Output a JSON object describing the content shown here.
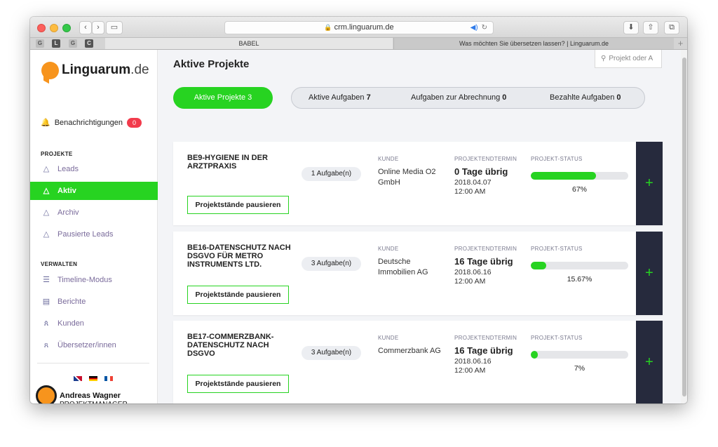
{
  "browser": {
    "url": "crm.linguarum.de",
    "tabs": [
      {
        "label": "BABEL"
      },
      {
        "label": "Was möchten Sie übersetzen lassen? | Linguarum.de"
      }
    ],
    "favicons": [
      "G",
      "L",
      "G",
      "C"
    ]
  },
  "sidebar": {
    "logo_name": "Linguarum",
    "logo_tld": ".de",
    "notifications_label": "Benachrichtigungen",
    "notifications_count": "0",
    "section_projects": "PROJEKTE",
    "section_manage": "VERWALTEN",
    "items": [
      {
        "label": "Leads",
        "icon": "triangle-icon"
      },
      {
        "label": "Aktiv",
        "icon": "triangle-icon"
      },
      {
        "label": "Archiv",
        "icon": "triangle-icon"
      },
      {
        "label": "Pausierte Leads",
        "icon": "triangle-icon"
      },
      {
        "label": "Timeline-Modus",
        "icon": "sliders-icon"
      },
      {
        "label": "Berichte",
        "icon": "document-icon"
      },
      {
        "label": "Kunden",
        "icon": "users-icon"
      },
      {
        "label": "Übersetzer/innen",
        "icon": "user-icon"
      }
    ],
    "user": {
      "name": "Andreas Wagner",
      "role": "PROJEKTMANAGER"
    }
  },
  "main": {
    "title": "Aktive Projekte",
    "search_placeholder": "Projekt oder A",
    "tabs": [
      {
        "label": "Aktive Projekte",
        "count": "3"
      },
      {
        "label": "Aktive Aufgaben",
        "count": "7"
      },
      {
        "label": "Aufgaben zur Abrechnung",
        "count": "0"
      },
      {
        "label": "Bezahlte Aufgaben",
        "count": "0"
      }
    ],
    "column_labels": {
      "customer": "KUNDE",
      "deadline": "PROJEKTENDTERMIN",
      "status": "PROJEKT-STATUS"
    },
    "pause_label": "Projektstände pausieren",
    "plus_label": "+",
    "projects": [
      {
        "name": "BE9-HYGIENE IN DER ARZTPRAXIS",
        "tasks": "1 Aufgabe(n)",
        "customer": "Online Media O2 GmbH",
        "days_left": "0 Tage übrig",
        "date": "2018.04.07",
        "time": "12:00 AM",
        "progress_label": "67%",
        "progress": 67
      },
      {
        "name": "BE16-DATENSCHUTZ NACH DSGVO FÜR METRO INSTRUMENTS LTD.",
        "tasks": "3 Aufgabe(n)",
        "customer": "Deutsche Immobilien AG",
        "days_left": "16 Tage übrig",
        "date": "2018.06.16",
        "time": "12:00 AM",
        "progress_label": "15.67%",
        "progress": 15.67
      },
      {
        "name": "BE17-COMMERZBANK-DATENSCHUTZ NACH DSGVO",
        "tasks": "3 Aufgabe(n)",
        "customer": "Commerzbank AG",
        "days_left": "16 Tage übrig",
        "date": "2018.06.16",
        "time": "12:00 AM",
        "progress_label": "7%",
        "progress": 7
      }
    ]
  },
  "colors": {
    "accent": "#27d321",
    "dark": "#262a3d",
    "badge": "#f23b4c",
    "brand_orange": "#f7941d"
  }
}
